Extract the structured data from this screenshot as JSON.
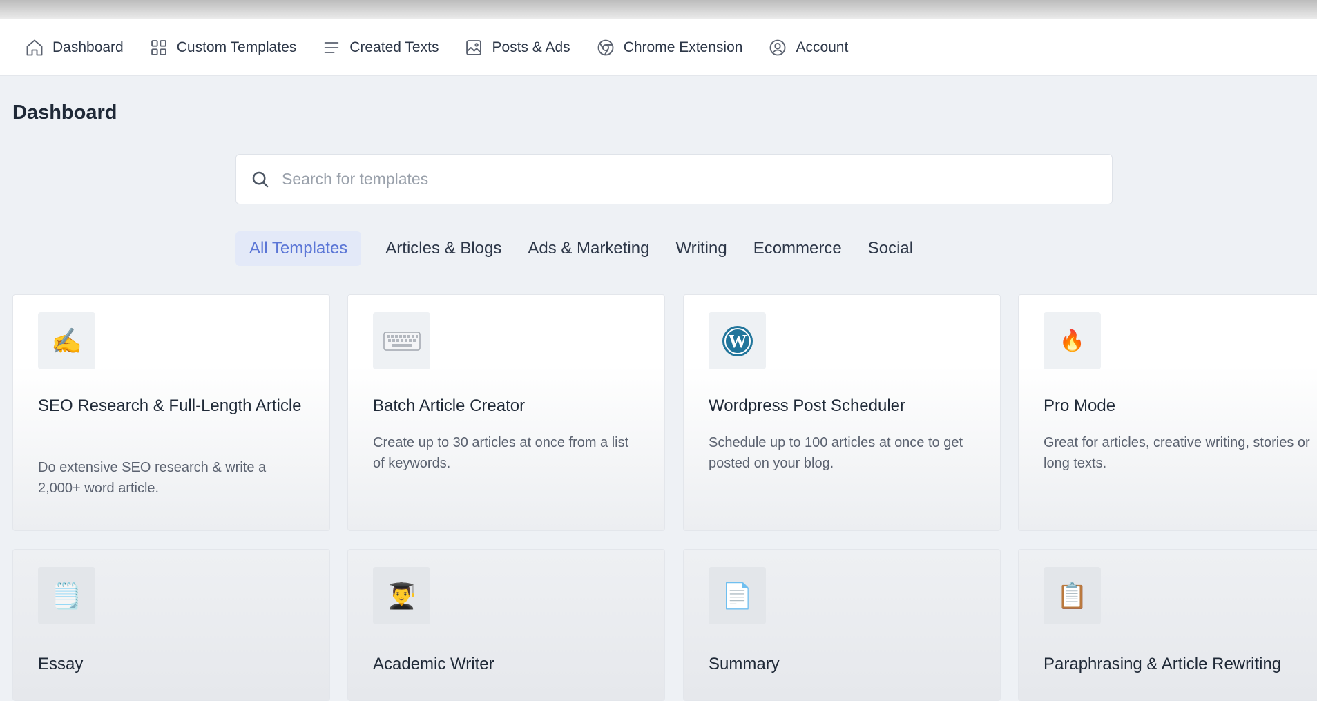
{
  "nav": {
    "items": [
      {
        "label": "Dashboard",
        "icon": "home-icon"
      },
      {
        "label": "Custom Templates",
        "icon": "grid-icon"
      },
      {
        "label": "Created Texts",
        "icon": "lines-icon"
      },
      {
        "label": "Posts & Ads",
        "icon": "image-icon"
      },
      {
        "label": "Chrome Extension",
        "icon": "chrome-icon"
      },
      {
        "label": "Account",
        "icon": "user-circle-icon"
      }
    ]
  },
  "page": {
    "title": "Dashboard"
  },
  "search": {
    "placeholder": "Search for templates",
    "value": ""
  },
  "filters": [
    {
      "label": "All Templates",
      "active": true
    },
    {
      "label": "Articles & Blogs",
      "active": false
    },
    {
      "label": "Ads & Marketing",
      "active": false
    },
    {
      "label": "Writing",
      "active": false
    },
    {
      "label": "Ecommerce",
      "active": false
    },
    {
      "label": "Social",
      "active": false
    }
  ],
  "cards": [
    {
      "title": "SEO Research & Full-Length Article",
      "description": "Do extensive SEO research & write a 2,000+ word article.",
      "icon": "writing-hand-icon",
      "glyph": "✍️"
    },
    {
      "title": "Batch Article Creator",
      "description": "Create up to 30 articles at once from a list of keywords.",
      "icon": "keyboard-icon",
      "glyph": "⌨️"
    },
    {
      "title": "Wordpress Post Scheduler",
      "description": "Schedule up to 100 articles at once to get posted on your blog.",
      "icon": "wordpress-icon",
      "glyph": "W"
    },
    {
      "title": "Pro Mode",
      "description": "Great for articles, creative writing, stories or long texts.",
      "icon": "fire-icon",
      "glyph": "🔥"
    },
    {
      "title": "Essay",
      "description": "",
      "icon": "notepad-icon",
      "glyph": "🗒️"
    },
    {
      "title": "Academic Writer",
      "description": "",
      "icon": "graduate-icon",
      "glyph": "👨‍🎓"
    },
    {
      "title": "Summary",
      "description": "",
      "icon": "document-icon",
      "glyph": "📄"
    },
    {
      "title": "Paraphrasing & Article Rewriting",
      "description": "",
      "icon": "clipboard-icon",
      "glyph": "📋"
    }
  ],
  "colors": {
    "accent": "#5b76d6",
    "accent_bg": "#e3e9f8",
    "wordpress": "#21759b"
  }
}
